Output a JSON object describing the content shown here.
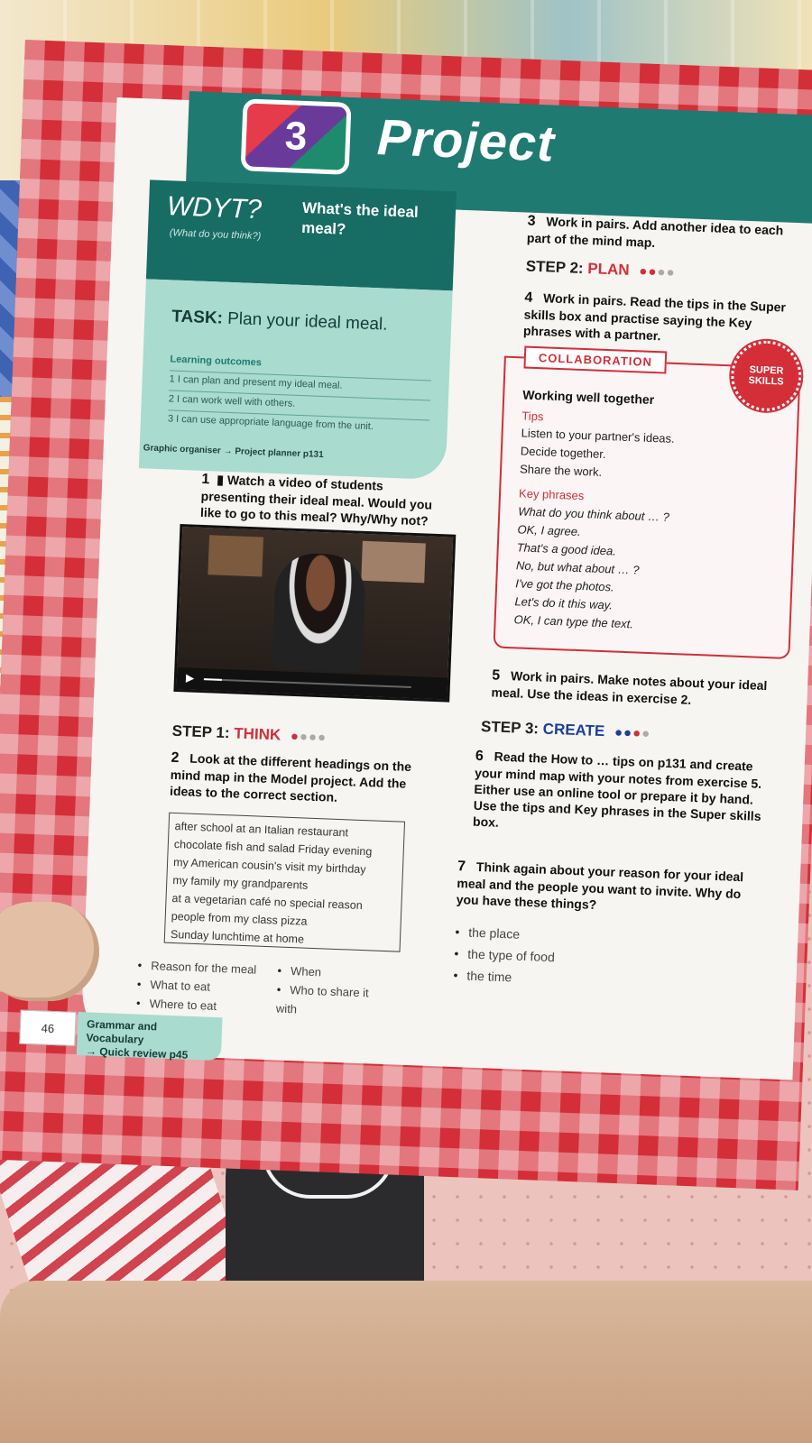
{
  "unit": {
    "number": "3",
    "title": "Project"
  },
  "wdyt": {
    "label": "WDYT?",
    "sub": "(What do you think?)",
    "question": "What's the ideal meal?"
  },
  "task": {
    "label": "TASK:",
    "text": "Plan your ideal meal.",
    "outcomes_title": "Learning outcomes",
    "outcomes": [
      "1  I can plan and present my ideal meal.",
      "2  I can work well with others.",
      "3  I can use appropriate language from the unit."
    ],
    "planner": "Graphic organiser → Project planner p131"
  },
  "exercises": {
    "ex1": {
      "num": "1",
      "text": "Watch a video of students presenting their ideal meal. Would you like to go to this meal? Why/Why not?"
    },
    "ex2": {
      "num": "2",
      "text": "Look at the different headings on the mind map in the Model project. Add the ideas to the correct section."
    },
    "ex3": {
      "num": "3",
      "text": "Work in pairs. Add another idea to each part of the mind map."
    },
    "ex4": {
      "num": "4",
      "text": "Work in pairs. Read the tips in the Super skills box and practise saying the Key phrases with a partner."
    },
    "ex5": {
      "num": "5",
      "text": "Work in pairs. Make notes about your ideal meal. Use the ideas in exercise 2."
    },
    "ex6": {
      "num": "6",
      "text": "Read the How to … tips on p131 and create your mind map with your notes from exercise 5. Either use an online tool or prepare it by hand. Use the tips and Key phrases in the Super skills box."
    },
    "ex7": {
      "num": "7",
      "text": "Think again about your reason for your ideal meal and the people you want to invite. Why do you have these things?"
    }
  },
  "steps": {
    "step1": {
      "label": "STEP 1:",
      "word": "THINK"
    },
    "step2": {
      "label": "STEP 2:",
      "word": "PLAN"
    },
    "step3": {
      "label": "STEP 3:",
      "word": "CREATE"
    }
  },
  "wordbox": [
    "after school   at an Italian restaurant",
    "chocolate   fish and salad   Friday evening",
    "my American cousin's visit   my birthday",
    "my family   my grandparents",
    "at a vegetarian café   no special reason",
    "people from my class   pizza",
    "Sunday lunchtime   at home"
  ],
  "headings_left": [
    "Reason for the meal",
    "What to eat",
    "Where to eat"
  ],
  "headings_right": [
    "When",
    "Who to share it with"
  ],
  "ex7_bullets": [
    "the place",
    "the type of food",
    "the time"
  ],
  "collaboration": {
    "tag": "COLLABORATION",
    "badge": "SUPER SKILLS",
    "heading": "Working well together",
    "tips_title": "Tips",
    "tips": [
      "Listen to your partner's ideas.",
      "Decide together.",
      "Share the work."
    ],
    "phrases_title": "Key phrases",
    "phrases": [
      "What do you think about … ?",
      "OK, I agree.",
      "That's a good idea.",
      "No, but what about … ?",
      "I've got the photos.",
      "Let's do it this way.",
      "OK, I can type the text."
    ]
  },
  "footer": {
    "page": "46",
    "gv_title": "Grammar and Vocabulary",
    "gv_link": "→ Quick review p45"
  },
  "colors": {
    "teal": "#1f7a72",
    "red": "#d42e38",
    "blue": "#1d3f9a",
    "mint": "#a9dbcf"
  }
}
